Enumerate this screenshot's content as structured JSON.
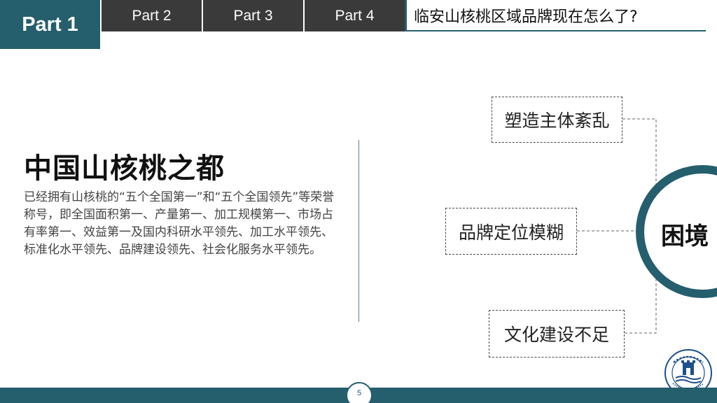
{
  "nav": {
    "active_tab": "Part 1",
    "tabs": [
      "Part 2",
      "Part 3",
      "Part 4"
    ],
    "section_title": "临安山核桃区域品牌现在怎么了?"
  },
  "content": {
    "heading": "中国山核桃之都",
    "description": "已经拥有山核桃的“五个全国第一”和“五个全国领先”等荣誉称号，即全国面积第一、产量第一、加工规模第一、市场占有率第一、效益第一及国内科研水平领先、加工水平领先、标准化水平领先、品牌建设领先、社会化服务水平领先。"
  },
  "diagram": {
    "core": "困境",
    "issues": [
      "塑造主体紊乱",
      "品牌定位模糊",
      "文化建设不足"
    ]
  },
  "footer": {
    "page_number": "5"
  },
  "colors": {
    "accent": "#255e6c",
    "tab_dark": "#3a3a3a"
  },
  "icons": {
    "logo": "university-seal-icon"
  }
}
